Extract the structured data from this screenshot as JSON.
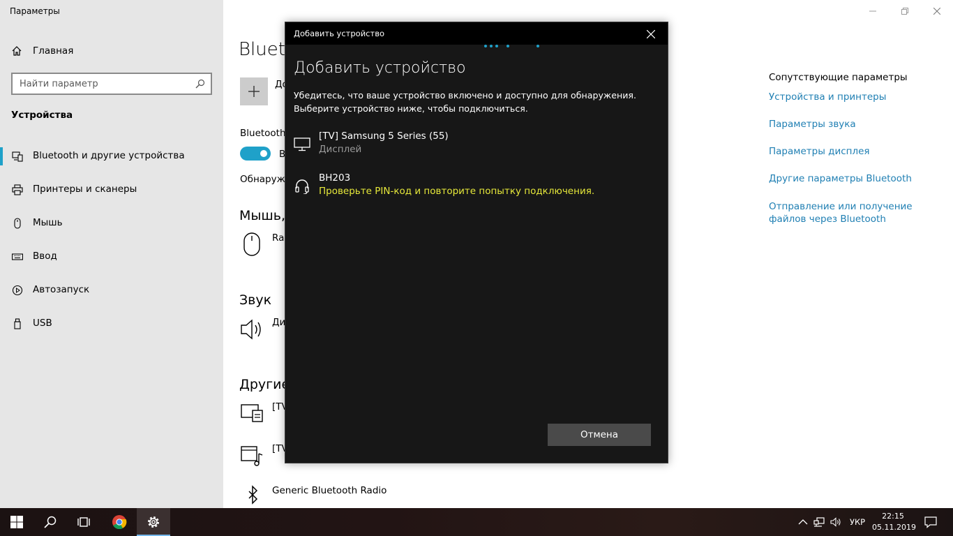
{
  "app": {
    "title": "Параметры"
  },
  "sidebar": {
    "home": "Главная",
    "search_placeholder": "Найти параметр",
    "section": "Устройства",
    "items": [
      {
        "label": "Bluetooth и другие устройства",
        "icon": "bluetooth-devices-icon",
        "active": true
      },
      {
        "label": "Принтеры и сканеры",
        "icon": "printer-icon"
      },
      {
        "label": "Мышь",
        "icon": "mouse-icon"
      },
      {
        "label": "Ввод",
        "icon": "keyboard-icon"
      },
      {
        "label": "Автозапуск",
        "icon": "autoplay-icon"
      },
      {
        "label": "USB",
        "icon": "usb-icon"
      }
    ]
  },
  "main": {
    "heading": "Blueto",
    "add_label": "До",
    "bluetooth_label": "Bluetooth",
    "toggle_label": "В",
    "discover_label": "Обнаружи",
    "mouse_group": "Мышь, ",
    "mouse_device": "Rap",
    "sound_group": "Звук",
    "sound_device": "Ди",
    "other_group": "Другие",
    "other_device_1": "[TV",
    "other_device_2": "[TV",
    "other_device_3": "Generic Bluetooth Radio"
  },
  "related": {
    "title": "Сопутствующие параметры",
    "links": [
      "Устройства и принтеры",
      "Параметры звука",
      "Параметры дисплея",
      "Другие параметры Bluetooth",
      "Отправление или получение файлов через Bluetooth"
    ]
  },
  "dialog": {
    "title": "Добавить устройство",
    "heading": "Добавить устройство",
    "instruction_1": "Убедитесь, что ваше устройство включено и доступно для обнаружения.",
    "instruction_2": "Выберите устройство ниже, чтобы подключиться.",
    "devices": [
      {
        "name": "[TV] Samsung 5 Series (55)",
        "status": "Дисплей",
        "icon": "display-icon"
      },
      {
        "name": "BH203",
        "status": "Проверьте PIN-код и повторите попытку подключения.",
        "icon": "headset-icon"
      }
    ],
    "cancel": "Отмена"
  },
  "taskbar": {
    "lang": "УКР",
    "time": "22:15",
    "date": "05.11.2019"
  },
  "colors": {
    "accent": "#1fa1c9",
    "link": "#1f7fb3",
    "warning": "#e6e83a"
  }
}
